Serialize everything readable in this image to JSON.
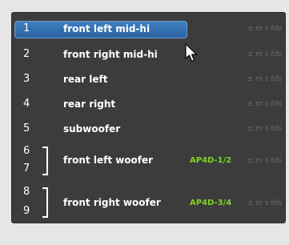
{
  "channels": [
    {
      "num": "1",
      "name": "front left mid-hi",
      "unit": "± m s fds",
      "selected": true
    },
    {
      "num": "2",
      "name": "front right mid-hi",
      "unit": "± m s fds"
    },
    {
      "num": "3",
      "name": "rear left",
      "unit": "± m s fds"
    },
    {
      "num": "4",
      "name": "rear right",
      "unit": "± m s fds"
    },
    {
      "num": "5",
      "name": "subwoofer",
      "unit": "± m s fds"
    }
  ],
  "pairs": [
    {
      "num_a": "6",
      "num_b": "7",
      "name": "front left woofer",
      "tag": "AP4D-1/2",
      "unit": "± m s fds"
    },
    {
      "num_a": "8",
      "num_b": "9",
      "name": "front right woofer",
      "tag": "AP4D-3/4",
      "unit": "± m s fds"
    }
  ],
  "colors": {
    "panel_bg": "#3c3c3c",
    "selected_bg": "#2f6db3",
    "tag_green": "#7ed321",
    "unit_gray": "#6c6c6c"
  },
  "icons": {
    "cursor": "arrow-pointer"
  }
}
